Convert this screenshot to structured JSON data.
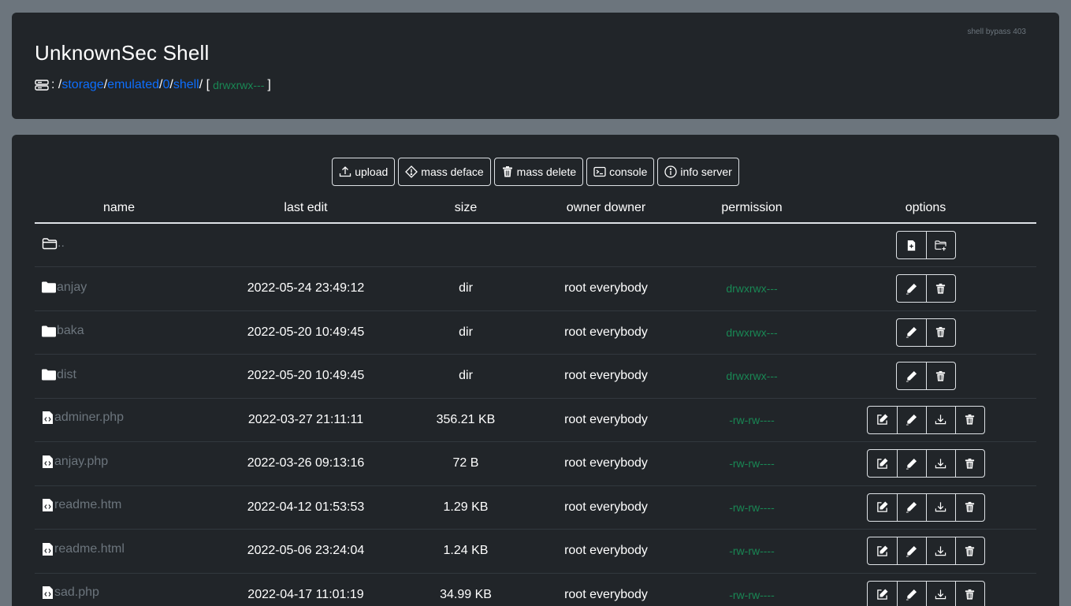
{
  "header": {
    "title": "UnknownSec Shell",
    "bypass_note": "shell bypass 403",
    "path_prefix": ":",
    "path_segments": [
      "storage",
      "emulated",
      "0",
      "shell"
    ],
    "path_open": "[",
    "path_permission": "drwxrwx---",
    "path_close": "]"
  },
  "toolbar": {
    "upload": "upload",
    "mass_deface": "mass deface",
    "mass_delete": "mass delete",
    "console": "console",
    "info_server": "info server"
  },
  "table": {
    "columns": [
      "name",
      "last edit",
      "size",
      "owner downer",
      "permission",
      "options"
    ],
    "parent_label": "..",
    "rows": [
      {
        "name": "anjay",
        "type": "dir",
        "last_edit": "2022-05-24 23:49:12",
        "size": "dir",
        "owner": "root everybody",
        "permission": "drwxrwx---"
      },
      {
        "name": "baka",
        "type": "dir",
        "last_edit": "2022-05-20 10:49:45",
        "size": "dir",
        "owner": "root everybody",
        "permission": "drwxrwx---"
      },
      {
        "name": "dist",
        "type": "dir",
        "last_edit": "2022-05-20 10:49:45",
        "size": "dir",
        "owner": "root everybody",
        "permission": "drwxrwx---"
      },
      {
        "name": "adminer.php",
        "type": "file",
        "last_edit": "2022-03-27 21:11:11",
        "size": "356.21 KB",
        "owner": "root everybody",
        "permission": "-rw-rw----"
      },
      {
        "name": "anjay.php",
        "type": "file",
        "last_edit": "2022-03-26 09:13:16",
        "size": "72 B",
        "owner": "root everybody",
        "permission": "-rw-rw----"
      },
      {
        "name": "readme.htm",
        "type": "file",
        "last_edit": "2022-04-12 01:53:53",
        "size": "1.29 KB",
        "owner": "root everybody",
        "permission": "-rw-rw----"
      },
      {
        "name": "readme.html",
        "type": "file",
        "last_edit": "2022-05-06 23:24:04",
        "size": "1.24 KB",
        "owner": "root everybody",
        "permission": "-rw-rw----"
      },
      {
        "name": "sad.php",
        "type": "file",
        "last_edit": "2022-04-17 11:01:19",
        "size": "34.99 KB",
        "owner": "root everybody",
        "permission": "-rw-rw----"
      }
    ]
  },
  "icons": {
    "parent_folder": "folder-outline-icon",
    "dir": "folder-fill-icon",
    "file": "file-code-icon",
    "new_file": "file-plus-icon",
    "new_folder": "folder-plus-icon",
    "edit": "pencil-square-icon",
    "rename": "pencil-icon",
    "download": "download-icon",
    "delete": "trash-icon"
  },
  "colors": {
    "page_bg": "#6c757d",
    "card_bg": "#212529",
    "link": "#0d6efd",
    "permission": "#198754",
    "muted": "#6c757d"
  }
}
